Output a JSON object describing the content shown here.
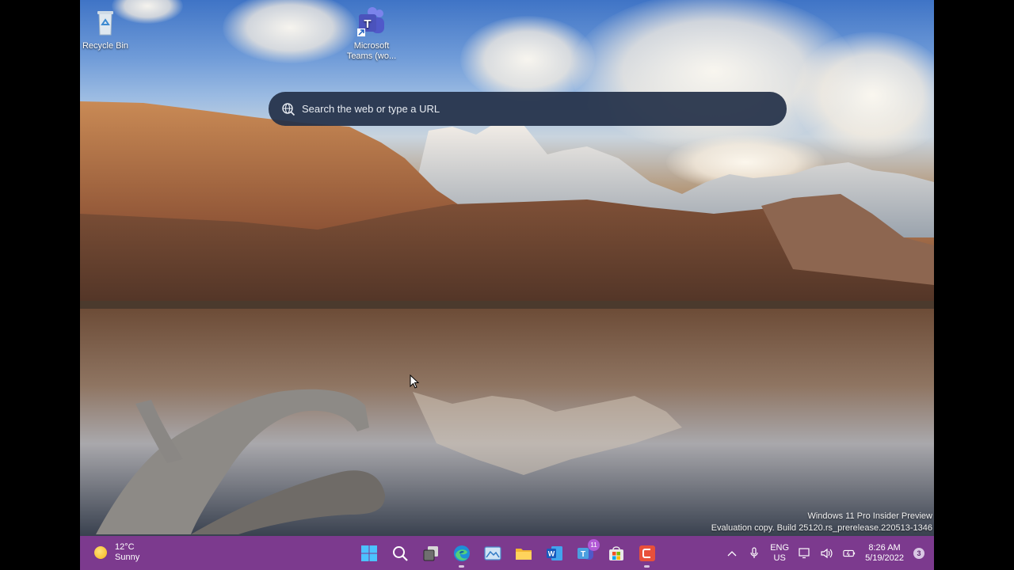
{
  "desktop": {
    "icons": [
      {
        "label": "Recycle Bin",
        "icon": "recycle-bin-icon"
      },
      {
        "label": "Microsoft Teams (wo...",
        "icon": "teams-icon"
      }
    ]
  },
  "search": {
    "placeholder": "Search the web or type a URL",
    "icon": "search-globe-icon"
  },
  "watermark": {
    "line1": "Windows 11 Pro Insider Preview",
    "line2": "Evaluation copy. Build 25120.rs_prerelease.220513-1346"
  },
  "taskbar": {
    "weather": {
      "temp": "12°C",
      "condition": "Sunny",
      "icon": "sun-icon"
    },
    "apps": [
      {
        "name": "start-button",
        "icon": "windows-logo-icon"
      },
      {
        "name": "search-button",
        "icon": "search-icon"
      },
      {
        "name": "task-view-button",
        "icon": "task-view-icon"
      },
      {
        "name": "edge-button",
        "icon": "edge-icon"
      },
      {
        "name": "photos-button",
        "icon": "photos-icon"
      },
      {
        "name": "file-explorer-button",
        "icon": "folder-icon"
      },
      {
        "name": "word-button",
        "icon": "word-icon"
      },
      {
        "name": "teams-button",
        "icon": "teams-icon",
        "badge": "11"
      },
      {
        "name": "store-button",
        "icon": "store-icon"
      },
      {
        "name": "snipping-tool-button",
        "icon": "snip-icon"
      }
    ],
    "tray": {
      "lang_top": "ENG",
      "lang_bottom": "US",
      "time": "8:26 AM",
      "date": "5/19/2022",
      "notifications": "3"
    }
  },
  "colors": {
    "taskbar": "#7c3a8e",
    "searchbar": "#233048"
  }
}
